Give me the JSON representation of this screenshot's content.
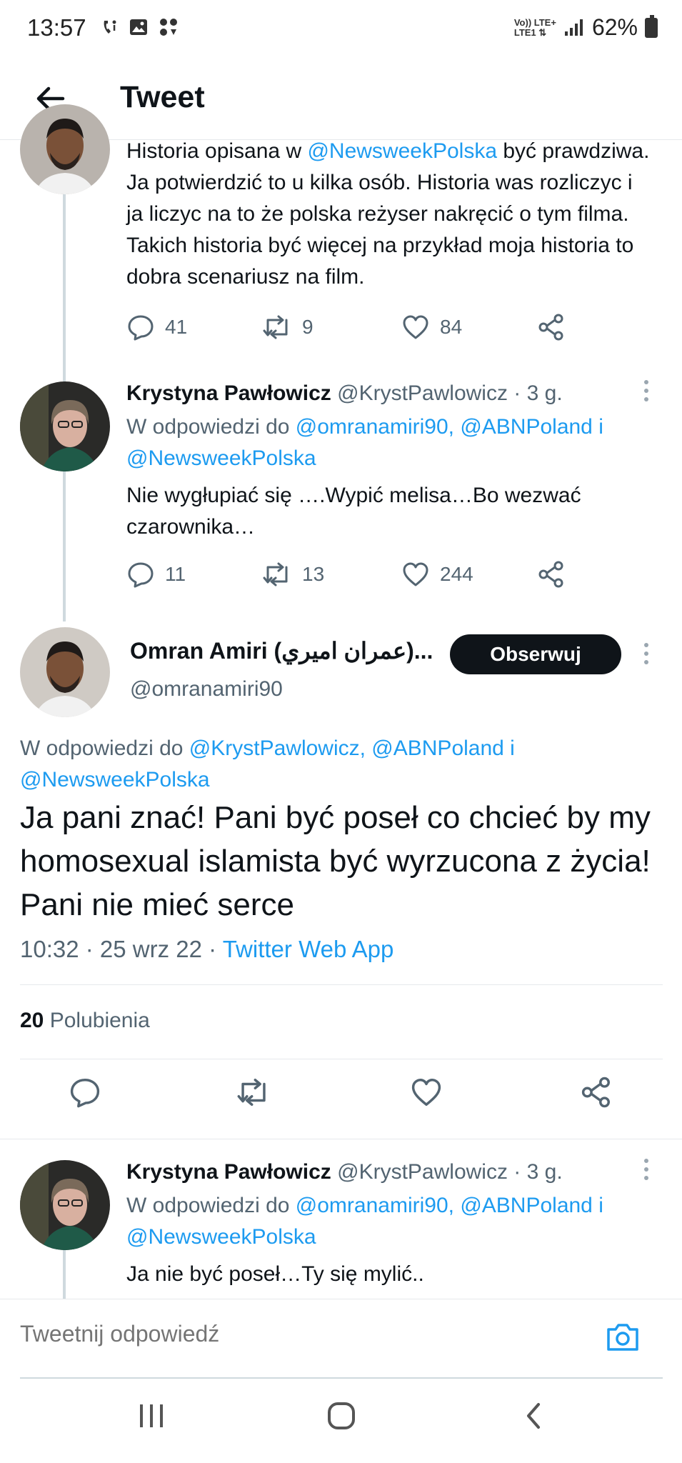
{
  "status_bar": {
    "time": "13:57",
    "network_top": "Vo)) LTE+",
    "network_bottom": "LTE1 ⇅",
    "battery": "62%"
  },
  "header": {
    "title": "Tweet"
  },
  "tweets": [
    {
      "author_name": "",
      "text_parts": [
        "Historia opisana w ",
        "@NewsweekPolska",
        " być prawdziwa. Ja potwierdzić to u kilka osób. Historia was rozliczyc i ja liczyc na to że polska reżyser nakręcić o tym filma. Takich historia być więcej na przykład moja historia to dobra scenariusz na film."
      ],
      "replies": "41",
      "retweets": "9",
      "likes": "84"
    },
    {
      "author_name": "Krystyna Pawłowicz",
      "handle": "@KrystPawlowicz",
      "time": "· 3 g.",
      "reply_to_prefix": "W odpowiedzi do ",
      "reply_to_links": "@omranamiri90, @ABNPoland i @NewsweekPolska",
      "text": "Nie wygłupiać się ….Wypić melisa…Bo wezwać czarownika…",
      "replies": "11",
      "retweets": "13",
      "likes": "244"
    }
  ],
  "main_tweet": {
    "author_name": "Omran Amiri (عمران اميري)...",
    "handle": "@omranamiri90",
    "follow_label": "Obserwuj",
    "reply_to_prefix": "W odpowiedzi do ",
    "reply_to_links": "@KrystPawlowicz, @ABNPoland i @NewsweekPolska",
    "text": "Ja pani znać! Pani być poseł co chcieć by my homosexual islamista być wyrzucona z życia! Pani nie mieć serce",
    "time_date": "10:32 · 25 wrz 22 · ",
    "source": "Twitter Web App",
    "likes_count": "20",
    "likes_label": "Polubienia"
  },
  "reply_below": {
    "author_name": "Krystyna Pawłowicz",
    "handle": "@KrystPawlowicz",
    "time": "· 3 g.",
    "reply_to_prefix": "W odpowiedzi do ",
    "reply_to_links": "@omranamiri90, @ABNPoland i @NewsweekPolska",
    "text": "Ja nie być poseł…Ty się mylić.."
  },
  "composer": {
    "placeholder": "Tweetnij odpowiedź"
  },
  "colors": {
    "link": "#1d9bf0",
    "text": "#0f1419",
    "secondary": "#536471",
    "follow_bg": "#0f1419"
  }
}
